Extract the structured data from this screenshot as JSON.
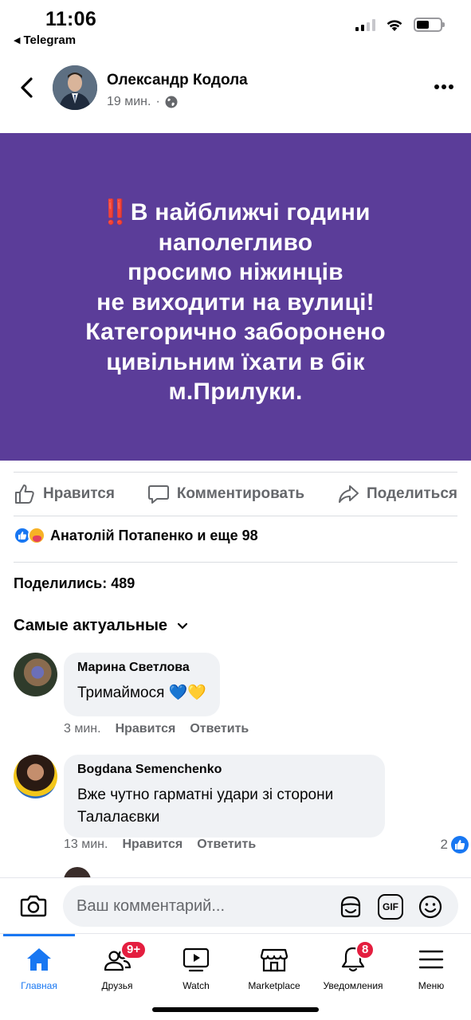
{
  "status": {
    "time": "11:06",
    "back_app": "Telegram"
  },
  "post": {
    "author": "Олександр Кодола",
    "time_ago": "19 мин.",
    "separator": "·",
    "banner_emoji": "‼️",
    "banner_lines": [
      "В найближчі години",
      "наполегливо",
      "просимо ніжинців",
      "не виходити на вулиці!",
      "Категорично заборонено",
      "цивільним їхати в бік",
      "м.Прилуки."
    ],
    "colors": {
      "banner_bg": "#5b3d99",
      "accent": "#1877f2",
      "badge": "#e41e3f"
    }
  },
  "actions": {
    "like": "Нравится",
    "comment": "Комментировать",
    "share": "Поделиться"
  },
  "reactions": {
    "summary": "Анатолій Потапенко и еще 98"
  },
  "shares": "Поделились: 489",
  "sort": {
    "label": "Самые актуальные"
  },
  "comments": [
    {
      "name": "Марина Светлова",
      "text": "Тримаймося 💙💛",
      "time": "3 мин.",
      "like": "Нравится",
      "reply": "Ответить"
    },
    {
      "name": "Bogdana Semenchenko",
      "text_lines": [
        "Вже чутно гарматні удари зі сторони",
        "Талалаєвки"
      ],
      "time": "13 мин.",
      "like": "Нравится",
      "reply": "Ответить",
      "likes_count": "2"
    }
  ],
  "composer": {
    "placeholder": "Ваш комментарий...",
    "gif": "GIF"
  },
  "tabs": [
    {
      "label": "Главная",
      "icon": "home-icon",
      "active": true
    },
    {
      "label": "Друзья",
      "icon": "friends-icon",
      "badge": "9+"
    },
    {
      "label": "Watch",
      "icon": "watch-icon"
    },
    {
      "label": "Marketplace",
      "icon": "marketplace-icon"
    },
    {
      "label": "Уведомления",
      "icon": "bell-icon",
      "badge": "8"
    },
    {
      "label": "Меню",
      "icon": "menu-icon"
    }
  ]
}
